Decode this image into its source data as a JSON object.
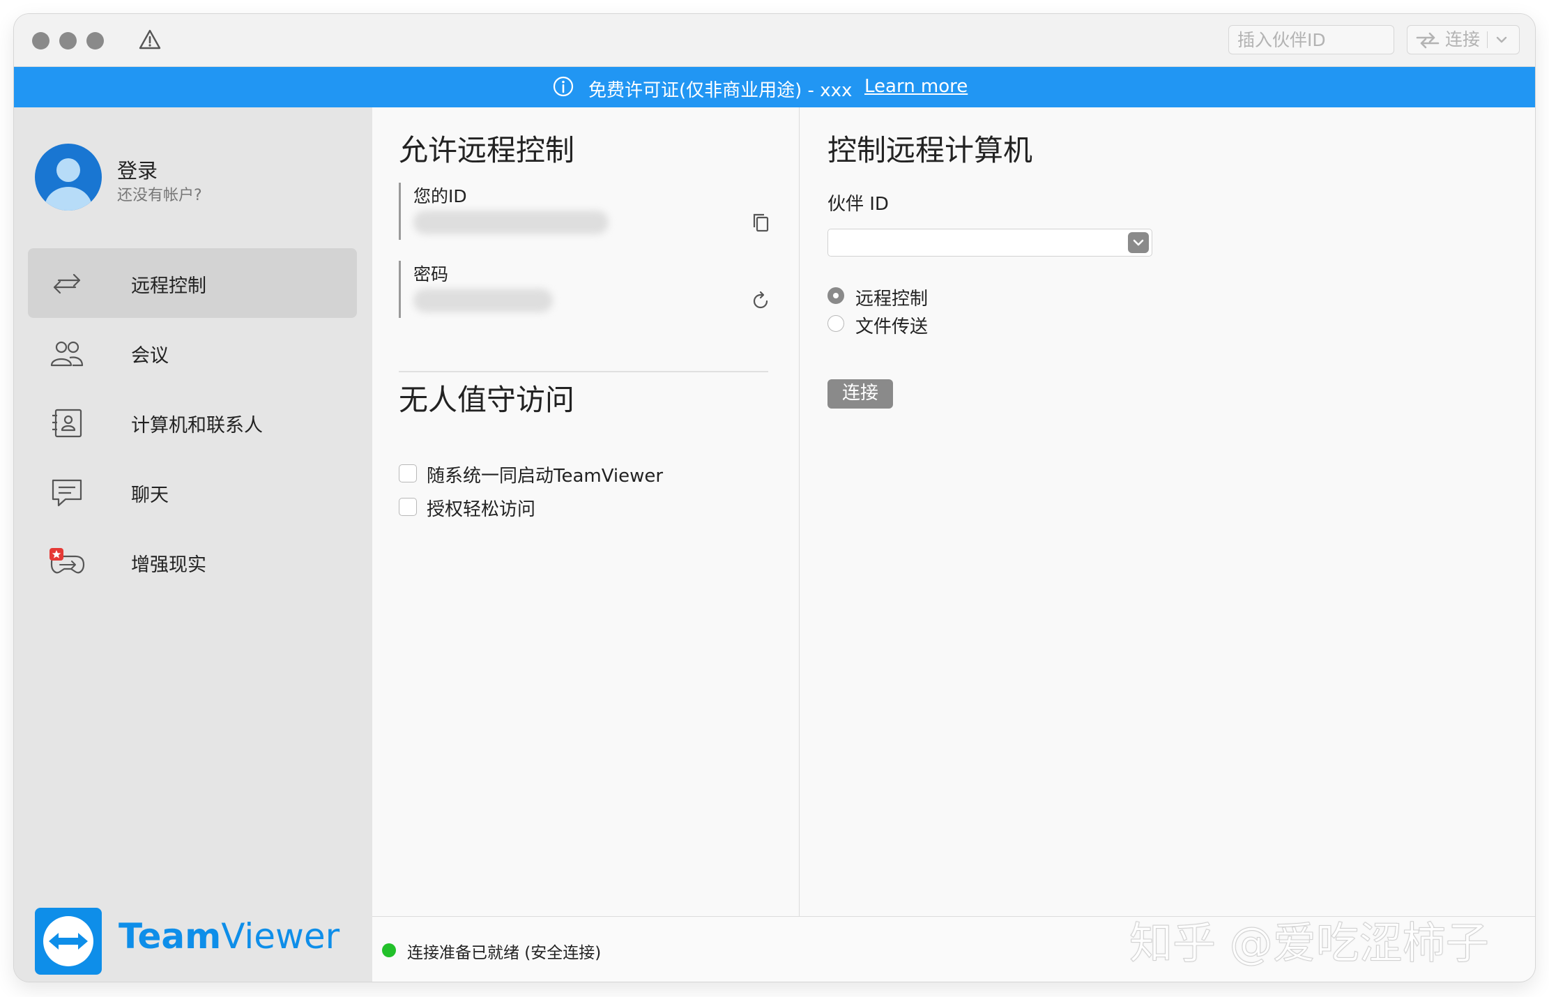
{
  "titlebar": {
    "partner_placeholder": "插入伙伴ID",
    "connect_label": "连接"
  },
  "banner": {
    "text": "免费许可证(仅非商业用途) - xxx",
    "link": "Learn more",
    "color": "#2196f3"
  },
  "sidebar": {
    "login_title": "登录",
    "login_sub": "还没有帐户?",
    "items": [
      {
        "label": "远程控制",
        "icon": "arrows-icon",
        "active": true
      },
      {
        "label": "会议",
        "icon": "meeting-icon"
      },
      {
        "label": "计算机和联系人",
        "icon": "contacts-icon"
      },
      {
        "label": "聊天",
        "icon": "chat-icon"
      },
      {
        "label": "增强现实",
        "icon": "ar-icon"
      }
    ],
    "brand_bold": "Team",
    "brand_light": "Viewer"
  },
  "allow": {
    "title": "允许远程控制",
    "id_label": "您的ID",
    "password_label": "密码"
  },
  "unattended": {
    "title": "无人值守访问",
    "options": [
      {
        "label": "随系统一同启动TeamViewer",
        "checked": false
      },
      {
        "label": "授权轻松访问",
        "checked": false
      }
    ]
  },
  "control": {
    "title": "控制远程计算机",
    "partner_label": "伙伴 ID",
    "modes": [
      {
        "label": "远程控制",
        "selected": true
      },
      {
        "label": "文件传送",
        "selected": false
      }
    ],
    "connect_button": "连接"
  },
  "status": {
    "text": "连接准备已就绪 (安全连接)",
    "color": "#22c02a"
  },
  "watermark": "知乎 @爱吃涩柿子"
}
